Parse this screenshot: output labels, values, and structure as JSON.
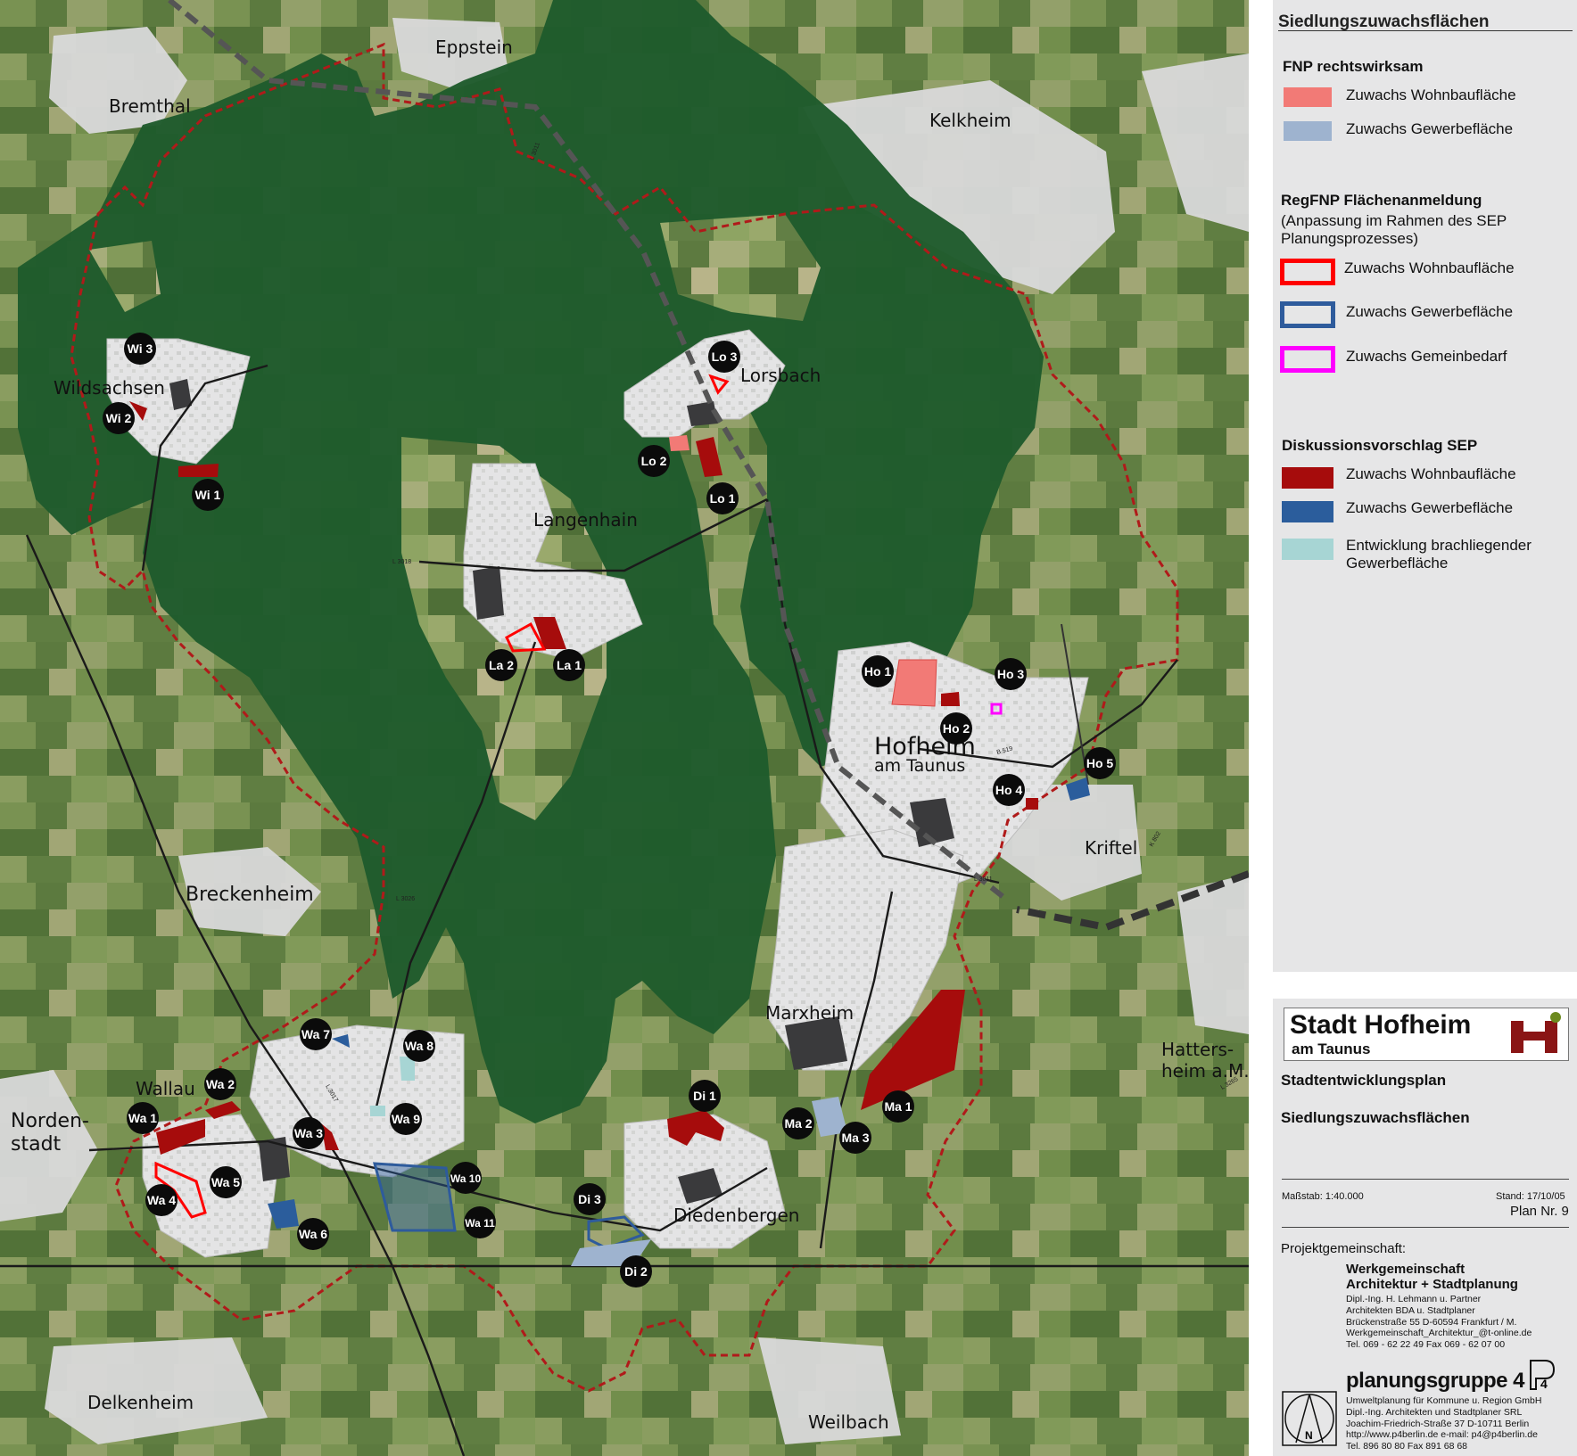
{
  "map": {
    "places": [
      {
        "id": "eppstein",
        "label": "Eppstein"
      },
      {
        "id": "bremthal",
        "label": "Bremthal"
      },
      {
        "id": "kelkheim",
        "label": "Kelkheim"
      },
      {
        "id": "lorsbach",
        "label": "Lorsbach"
      },
      {
        "id": "wildsachsen",
        "label": "Wildsachsen"
      },
      {
        "id": "langenhain",
        "label": "Langenhain"
      },
      {
        "id": "hofheim",
        "label": "Hofheim"
      },
      {
        "id": "hofheim2",
        "label": "am Taunus"
      },
      {
        "id": "kriftel",
        "label": "Kriftel"
      },
      {
        "id": "breckenheim",
        "label": "Breckenheim"
      },
      {
        "id": "marxheim",
        "label": "Marxheim"
      },
      {
        "id": "hattersheim1",
        "label": "Hatters-"
      },
      {
        "id": "hattersheim2",
        "label": "heim a.M."
      },
      {
        "id": "wallau",
        "label": "Wallau"
      },
      {
        "id": "nordenstadt1",
        "label": "Norden-"
      },
      {
        "id": "nordenstadt2",
        "label": "stadt"
      },
      {
        "id": "diedenbergen",
        "label": "Diedenbergen"
      },
      {
        "id": "delkenheim",
        "label": "Delkenheim"
      },
      {
        "id": "weilbach",
        "label": "Weilbach"
      }
    ],
    "markers": [
      "Wi 3",
      "Wi 2",
      "Wi 1",
      "Lo 3",
      "Lo 2",
      "Lo 1",
      "La 2",
      "La 1",
      "Ho 1",
      "Ho 3",
      "Ho 2",
      "Ho 5",
      "Ho 4",
      "Wa 7",
      "Wa 8",
      "Wa 2",
      "Wa 1",
      "Wa 3",
      "Wa 9",
      "Wa 5",
      "Wa 4",
      "Wa 10",
      "Wa 11",
      "Wa 6",
      "Di 1",
      "Di 3",
      "Di 2",
      "Ma 2",
      "Ma 1",
      "Ma 3"
    ],
    "road_labels": [
      "L 3011",
      "L 3018",
      "L 3026",
      "B 519",
      "L 3011",
      "L 3017",
      "K 802",
      "L 3265"
    ]
  },
  "legend": {
    "title": "Siedlungszuwachsflächen",
    "sections": [
      {
        "heading": "FNP rechtswirksam",
        "subheading": "",
        "items": [
          {
            "label": "Zuwachs Wohnbaufläche",
            "style": "fill",
            "color": "#f27a76"
          },
          {
            "label": "Zuwachs Gewerbefläche",
            "style": "fill",
            "color": "#9eb3cf"
          }
        ]
      },
      {
        "heading": "RegFNP Flächenanmeldung",
        "subheading": "(Anpassung im Rahmen des SEP Planungsprozesses)",
        "items": [
          {
            "label": "Zuwachs Wohnbaufläche",
            "style": "outline",
            "color": "#ff0000"
          },
          {
            "label": "Zuwachs Gewerbefläche",
            "style": "outline",
            "color": "#2e5b9c"
          },
          {
            "label": "Zuwachs Gemeinbedarf",
            "style": "outline",
            "color": "#ff00ff"
          }
        ]
      },
      {
        "heading": "Diskussionsvorschlag SEP",
        "subheading": "",
        "items": [
          {
            "label": "Zuwachs Wohnbaufläche",
            "style": "fill",
            "color": "#a60c0c"
          },
          {
            "label": "Zuwachs Gewerbefläche",
            "style": "fill",
            "color": "#2b5d9c"
          },
          {
            "label": "Entwicklung brachliegender Gewerbefläche",
            "style": "fill",
            "color": "#a7d5d4"
          }
        ]
      }
    ]
  },
  "title_block": {
    "city": "Stadt Hofheim",
    "city_sub": "am Taunus",
    "plan_title": "Stadtentwicklungsplan",
    "plan_subtitle": "Siedlungszuwachsflächen",
    "scale": "Maßstab: 1:40.000",
    "date": "Stand: 17/10/05",
    "plan_no": "Plan Nr. 9",
    "project_label": "Projektgemeinschaft:",
    "firm1_name_1": "Werkgemeinschaft",
    "firm1_name_2": "Architektur + Stadtplanung",
    "firm1_lines": [
      "Dipl.-Ing. H. Lehmann u. Partner",
      "Architekten BDA u. Stadtplaner",
      "Brückenstraße 55   D-60594 Frankfurt / M.",
      "Werkgemeinschaft_Architektur_@t-online.de",
      "Tel. 069 - 62 22 49   Fax 069 - 62 07 00"
    ],
    "firm2_name": "planungsgruppe 4",
    "firm2_lines": [
      "Umweltplanung für Kommune u. Region GmbH",
      "Dipl.-Ing. Architekten und Stadtplaner SRL",
      "Joachim-Friedrich-Straße 37   D-10711 Berlin",
      "http://www.p4berlin.de e-mail: p4@p4berlin.de",
      "Tel. 896 80 80   Fax 891 68 68"
    ],
    "north_label": "N"
  },
  "colors": {
    "forest": "#1f5b2c",
    "settlement": "#e3e3e4",
    "boundary": "#b01a1a",
    "marker": "#0b0b0b"
  }
}
